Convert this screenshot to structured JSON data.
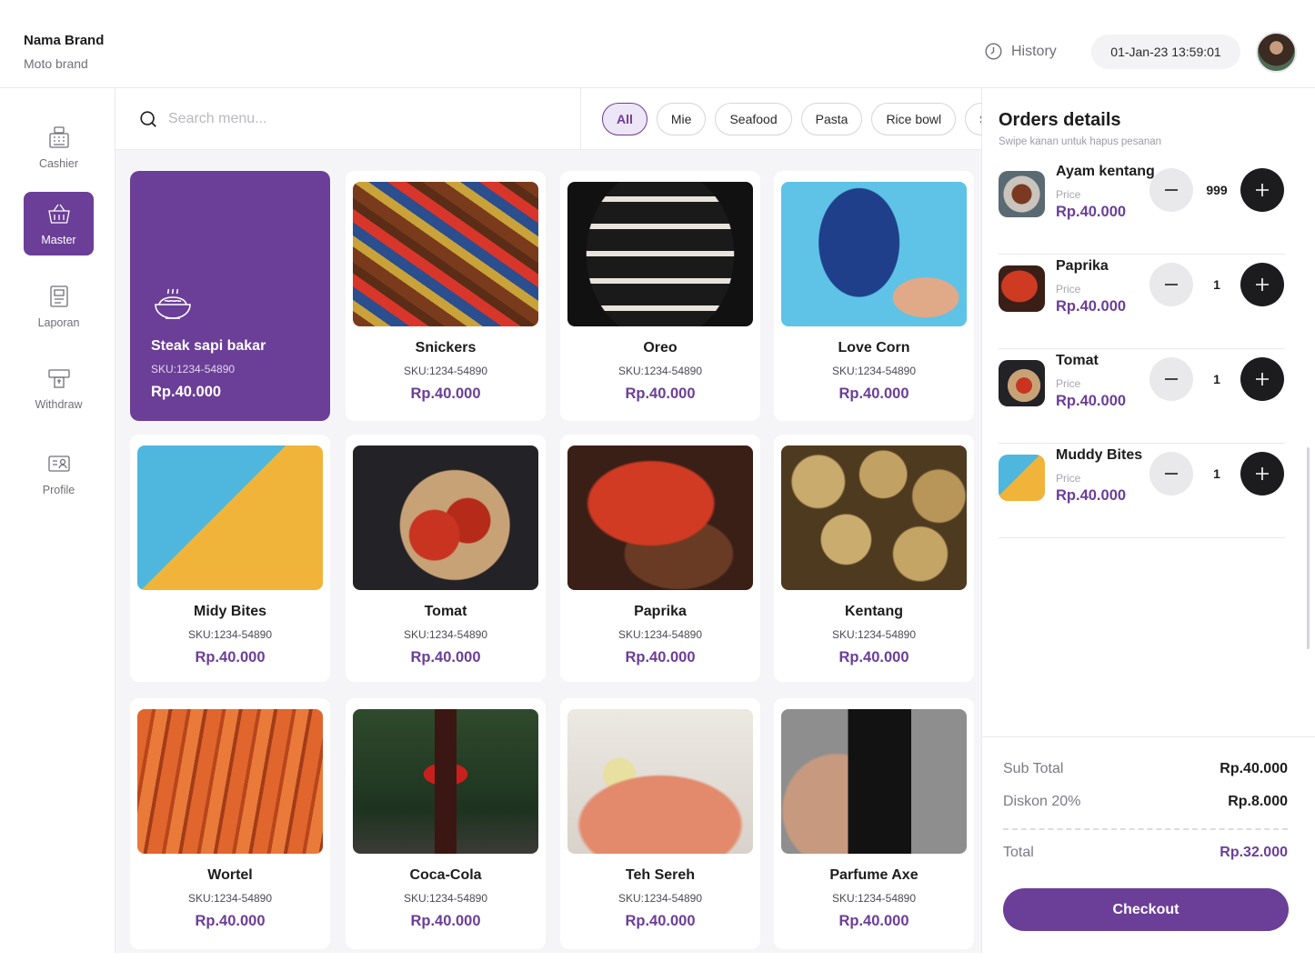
{
  "header": {
    "brand_name": "Nama Brand",
    "brand_motto": "Moto brand",
    "history_label": "History",
    "datetime": "01-Jan-23 13:59:01"
  },
  "sidebar": {
    "items": [
      {
        "label": "Cashier",
        "icon": "cash-register-icon",
        "active": false
      },
      {
        "label": "Master",
        "icon": "basket-icon",
        "active": true
      },
      {
        "label": "Laporan",
        "icon": "report-icon",
        "active": false
      },
      {
        "label": "Withdraw",
        "icon": "atm-withdraw-icon",
        "active": false
      },
      {
        "label": "Profile",
        "icon": "id-card-icon",
        "active": false
      }
    ]
  },
  "search": {
    "placeholder": "Search menu..."
  },
  "categories": [
    "All",
    "Mie",
    "Seafood",
    "Pasta",
    "Rice bowl",
    "Salad"
  ],
  "active_category": "All",
  "products": [
    {
      "name": "Steak sapi bakar",
      "sku": "SKU:1234-54890",
      "price": "Rp.40.000",
      "featured": true
    },
    {
      "name": "Snickers",
      "sku": "SKU:1234-54890",
      "price": "Rp.40.000"
    },
    {
      "name": "Oreo",
      "sku": "SKU:1234-54890",
      "price": "Rp.40.000"
    },
    {
      "name": "Love Corn",
      "sku": "SKU:1234-54890",
      "price": "Rp.40.000"
    },
    {
      "name": "Midy Bites",
      "sku": "SKU:1234-54890",
      "price": "Rp.40.000"
    },
    {
      "name": "Tomat",
      "sku": "SKU:1234-54890",
      "price": "Rp.40.000"
    },
    {
      "name": "Paprika",
      "sku": "SKU:1234-54890",
      "price": "Rp.40.000"
    },
    {
      "name": "Kentang",
      "sku": "SKU:1234-54890",
      "price": "Rp.40.000"
    },
    {
      "name": "Wortel",
      "sku": "SKU:1234-54890",
      "price": "Rp.40.000"
    },
    {
      "name": "Coca-Cola",
      "sku": "SKU:1234-54890",
      "price": "Rp.40.000"
    },
    {
      "name": "Teh Sereh",
      "sku": "SKU:1234-54890",
      "price": "Rp.40.000"
    },
    {
      "name": "Parfume Axe",
      "sku": "SKU:1234-54890",
      "price": "Rp.40.000"
    }
  ],
  "orders": {
    "title": "Orders details",
    "hint": "Swipe kanan untuk hapus pesanan",
    "price_label": "Price",
    "items": [
      {
        "name": "Ayam kentang",
        "price": "Rp.40.000",
        "qty": "999"
      },
      {
        "name": "Paprika",
        "price": "Rp.40.000",
        "qty": "1"
      },
      {
        "name": "Tomat",
        "price": "Rp.40.000",
        "qty": "1"
      },
      {
        "name": "Muddy Bites",
        "price": "Rp.40.000",
        "qty": "1"
      }
    ]
  },
  "summary": {
    "subtotal_label": "Sub Total",
    "subtotal_value": "Rp.40.000",
    "discount_label": "Diskon 20%",
    "discount_value": "Rp.8.000",
    "total_label": "Total",
    "total_value": "Rp.32.000",
    "checkout_label": "Checkout"
  },
  "colors": {
    "accent": "#6b3e97",
    "accent_light": "#ede6f6",
    "dark_button": "#1c1c1e",
    "muted_text": "#6f6f78"
  }
}
